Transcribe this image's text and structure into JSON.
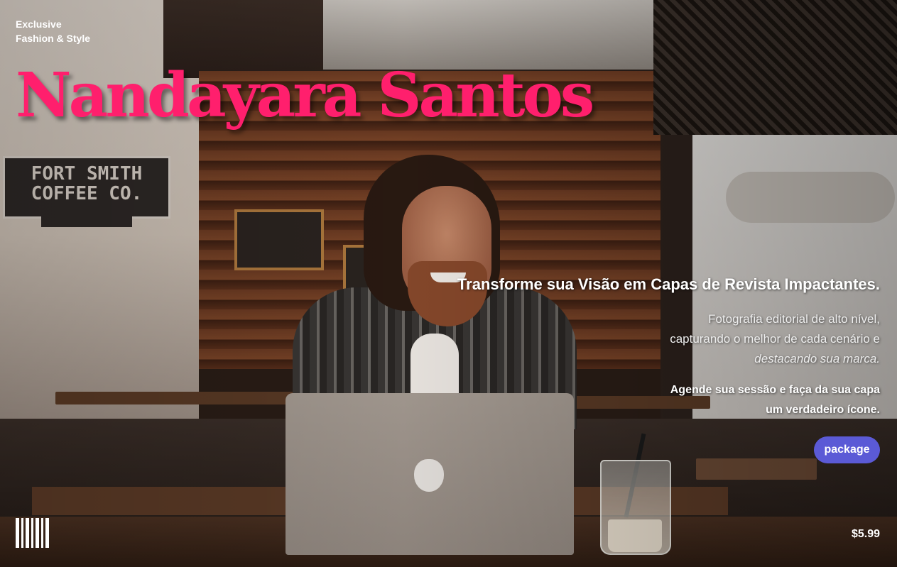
{
  "brand": {
    "eyebrow_line1": "Exclusive",
    "eyebrow_line2": "Fashion & Style",
    "title": "Nandayara Santos",
    "title_color": "#ff1f6d"
  },
  "background": {
    "sign_text": "FORT SMITH COFFEE CO."
  },
  "hero": {
    "headline": "Transforme sua Visão em Capas de Revista Impactantes.",
    "desc_line1": "Fotografia editorial de alto nível,",
    "desc_line2": "capturando o melhor de cada cenário e",
    "desc_line3": "destacando sua marca.",
    "cta_line1": "Agende sua sessão e faça da sua capa",
    "cta_line2": "um verdadeiro ícone."
  },
  "actions": {
    "package_label": "package",
    "package_color": "#5b5ad6"
  },
  "footer": {
    "barcode_icon": "barcode-icon",
    "price": "$5.99"
  }
}
